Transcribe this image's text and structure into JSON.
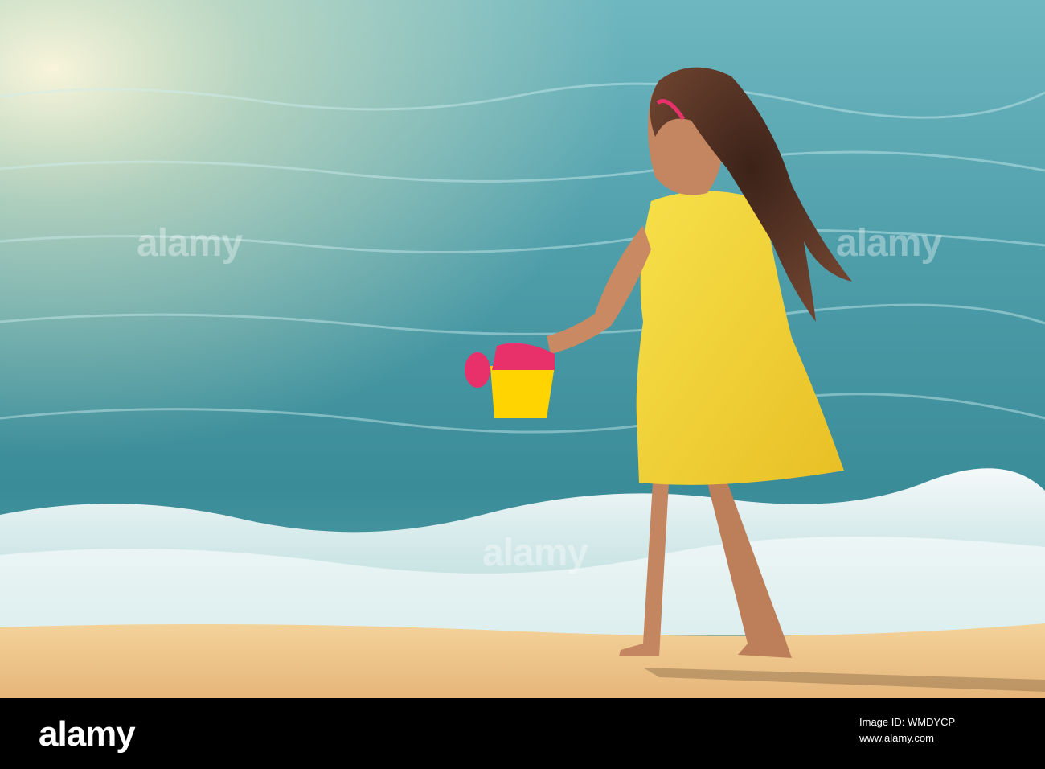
{
  "photo": {
    "subject": "girl-in-yellow-dress",
    "colors": {
      "sea_light": "#8fd3d6",
      "sea_deep": "#2f8795",
      "sand": "#f0c98c",
      "dress": "#f5d53a",
      "hair": "#4a2c1e",
      "skin": "#c98a63",
      "can_yellow": "#ffd400",
      "can_pink": "#e8306b"
    }
  },
  "watermarks": {
    "text": "alamy"
  },
  "footer": {
    "logo": "alamy",
    "image_id": "Image ID: WMDYCP",
    "url": "www.alamy.com"
  }
}
